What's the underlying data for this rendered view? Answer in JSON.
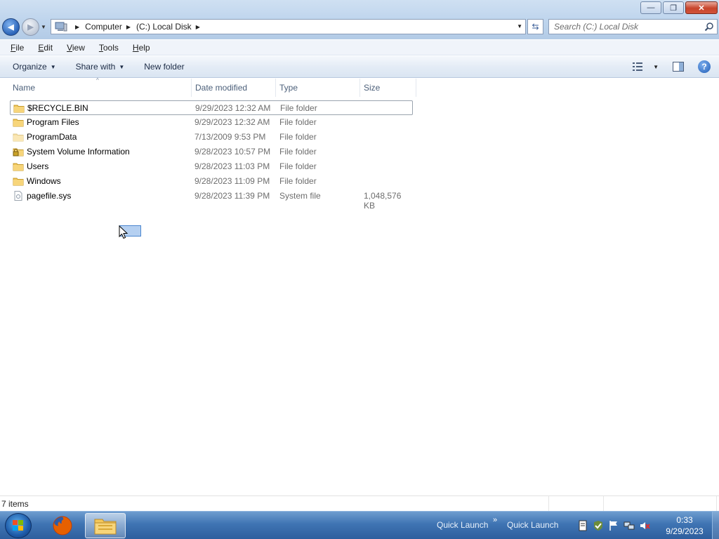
{
  "window": {
    "minimize_label": "—",
    "maximize_label": "❐",
    "close_label": "✕"
  },
  "nav": {
    "back_glyph": "◀",
    "forward_glyph": "▶"
  },
  "address": {
    "crumbs": [
      "Computer",
      "(C:) Local Disk"
    ]
  },
  "search": {
    "placeholder": "Search (C:) Local Disk"
  },
  "menu": {
    "items": [
      "File",
      "Edit",
      "View",
      "Tools",
      "Help"
    ],
    "accel": [
      "F",
      "E",
      "V",
      "T",
      "H"
    ],
    "rest": [
      "ile",
      "dit",
      "iew",
      "ools",
      "elp"
    ]
  },
  "toolbar": {
    "organize": "Organize",
    "share_with": "Share with",
    "new_folder": "New folder"
  },
  "columns": {
    "name": "Name",
    "date_modified": "Date modified",
    "type": "Type",
    "size": "Size"
  },
  "files": [
    {
      "name": "$RECYCLE.BIN",
      "date": "9/29/2023 12:32 AM",
      "type": "File folder",
      "size": "",
      "icon": "folder-icon"
    },
    {
      "name": "Program Files",
      "date": "9/29/2023 12:32 AM",
      "type": "File folder",
      "size": "",
      "icon": "folder-icon"
    },
    {
      "name": "ProgramData",
      "date": "7/13/2009 9:53 PM",
      "type": "File folder",
      "size": "",
      "icon": "folder-icon"
    },
    {
      "name": "System Volume Information",
      "date": "9/28/2023 10:57 PM",
      "type": "File folder",
      "size": "",
      "icon": "locked-folder-icon"
    },
    {
      "name": "Users",
      "date": "9/28/2023 11:03 PM",
      "type": "File folder",
      "size": "",
      "icon": "folder-icon"
    },
    {
      "name": "Windows",
      "date": "9/28/2023 11:09 PM",
      "type": "File folder",
      "size": "",
      "icon": "folder-icon"
    },
    {
      "name": "pagefile.sys",
      "date": "9/28/2023 11:39 PM",
      "type": "System file",
      "size": "1,048,576 KB",
      "icon": "system-file-icon"
    }
  ],
  "status": {
    "item_count": "7 items"
  },
  "taskbar": {
    "quick_launch_1": "Quick Launch",
    "quick_launch_2": "Quick Launch",
    "time": "0:33",
    "date": "9/29/2023"
  },
  "colors": {
    "accent": "#3f74b3",
    "selection": "#9aa3ae"
  }
}
